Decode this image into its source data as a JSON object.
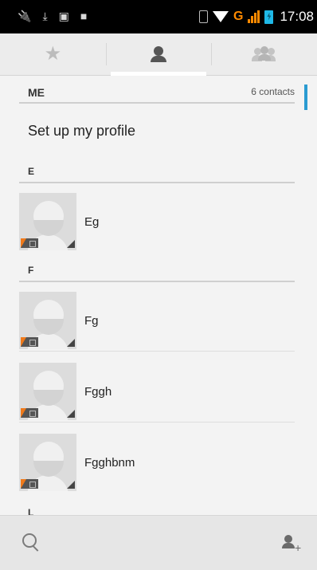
{
  "statusbar": {
    "network": "G",
    "time": "17:08",
    "left_icons": [
      "usb-icon",
      "download-icon",
      "image-icon",
      "storage-icon"
    ]
  },
  "tabs": [
    {
      "name": "favorites",
      "icon": "star-icon",
      "active": false
    },
    {
      "name": "contacts",
      "icon": "person-icon",
      "active": true
    },
    {
      "name": "groups",
      "icon": "group-icon",
      "active": false
    }
  ],
  "me_header": {
    "label": "ME",
    "count": "6 contacts"
  },
  "profile_label": "Set up my profile",
  "sections": [
    {
      "letter": "E",
      "contacts": [
        "Eg"
      ]
    },
    {
      "letter": "F",
      "contacts": [
        "Fg",
        "Fggh",
        "Fgghbnm"
      ]
    },
    {
      "letter": "L",
      "contacts": []
    }
  ],
  "bottombar": {
    "left_icon": "search-icon",
    "right_icon": "add-contact-icon"
  },
  "colors": {
    "accent": "#2b9bd1",
    "network": "#ff8a00",
    "badge": "#f07a1a"
  }
}
